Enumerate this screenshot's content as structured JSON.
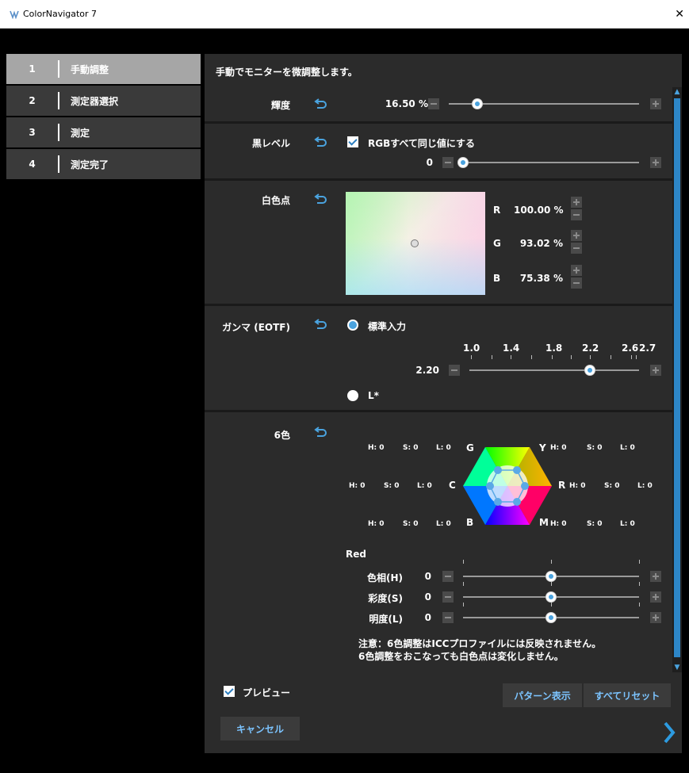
{
  "window": {
    "title": "ColorNavigator 7",
    "close": "✕"
  },
  "steps": [
    {
      "num": "1",
      "label": "手動調整"
    },
    {
      "num": "2",
      "label": "測定器選択"
    },
    {
      "num": "3",
      "label": "測定"
    },
    {
      "num": "4",
      "label": "測定完了"
    }
  ],
  "intro": "手動でモニターを微調整します。",
  "brightness": {
    "label": "輝度",
    "value": "16.50 %",
    "level": 0.15
  },
  "black": {
    "label": "黒レベル",
    "checkbox_label": "RGBすべて同じ値にする",
    "value": "0",
    "level": 0.0
  },
  "whitepoint": {
    "label": "白色点",
    "channels": [
      {
        "name": "R",
        "value": "100.00 %"
      },
      {
        "name": "G",
        "value": "93.02 %"
      },
      {
        "name": "B",
        "value": "75.38 %"
      }
    ]
  },
  "gamma": {
    "label": "ガンマ (EOTF)",
    "option1": "標準入力",
    "option2": "L*",
    "value": "2.20",
    "scale_labels": [
      "1.0",
      "1.4",
      "1.8",
      "2.2",
      "2.6",
      "2.7"
    ],
    "level": 0.71
  },
  "sixcolor": {
    "label": "6色",
    "letters": {
      "G": "G",
      "Y": "Y",
      "C": "C",
      "R": "R",
      "B": "B",
      "M": "M"
    },
    "hsl": {
      "h": "H: 0",
      "s": "S: 0",
      "l": "L: 0"
    },
    "selected": "Red",
    "rows": [
      {
        "label": "色相(H)",
        "value": "0",
        "level": 0.5
      },
      {
        "label": "彩度(S)",
        "value": "0",
        "level": 0.5
      },
      {
        "label": "明度(L)",
        "value": "0",
        "level": 0.5
      }
    ],
    "note1": "注意：6色調整はICCプロファイルには反映されません。",
    "note2": "6色調整をおこなっても白色点は変化しません。"
  },
  "footer": {
    "preview": "プレビュー",
    "pattern": "パターン表示",
    "reset_all": "すべてリセット",
    "cancel": "キャンセル"
  }
}
